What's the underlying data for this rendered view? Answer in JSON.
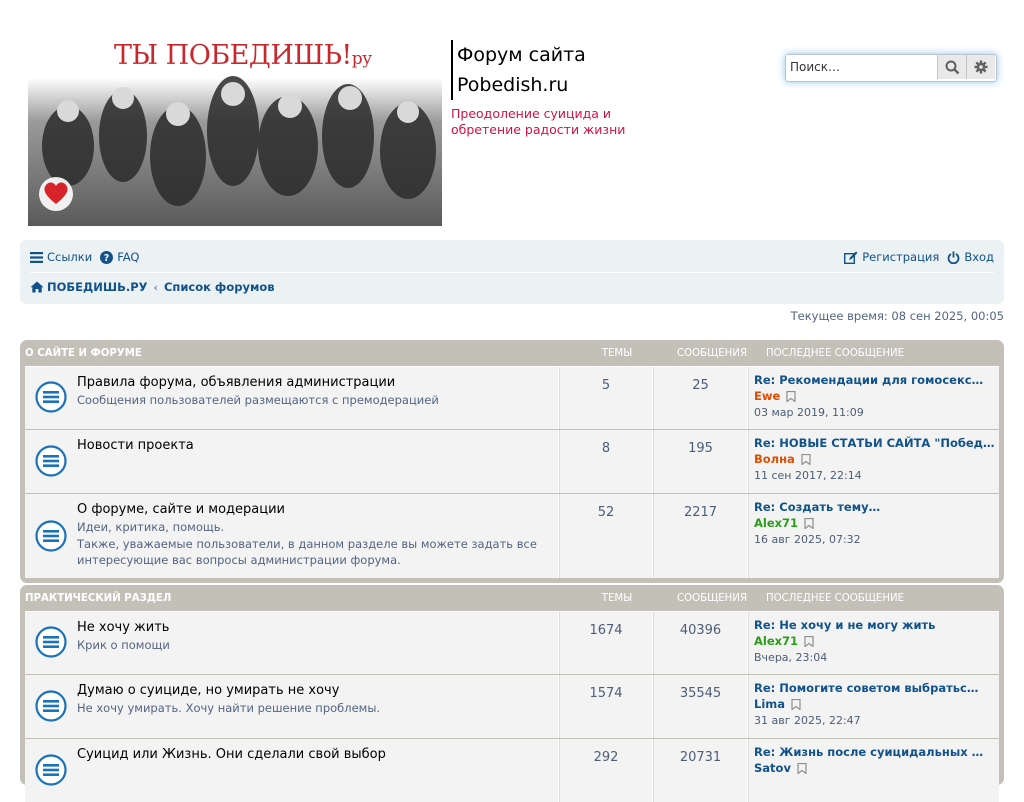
{
  "header": {
    "banner_title": "ТЫ ПОБЕДИШЬ!",
    "banner_suffix": "ру",
    "site_name_line1": "Форум сайта",
    "site_name_line2": "Pobedish.ru",
    "site_desc": "Преодоление суицида и обретение радости жизни",
    "search_placeholder": "Поиск…"
  },
  "nav": {
    "links": "Ссылки",
    "faq": "FAQ",
    "register": "Регистрация",
    "login": "Вход",
    "crumb_home": "ПОБЕДИШЬ.РУ",
    "crumb_sep": "‹",
    "crumb_forums": "Список форумов"
  },
  "current_time": "Текущее время: 08 сен 2025, 00:05",
  "blocks": [
    {
      "title": "О САЙТЕ И ФОРУМЕ",
      "col_topics": "ТЕМЫ",
      "col_posts": "СООБЩЕНИЯ",
      "col_last": "ПОСЛЕДНЕЕ СООБЩЕНИЕ",
      "forums": [
        {
          "title": "Правила форума, объявления администрации",
          "desc": "Сообщения пользователей размещаются с премодерацией",
          "desc2": "",
          "topics": "5",
          "posts": "25",
          "last_title": "Re: Рекомендации для гомосекс…",
          "last_author": "Ewe",
          "author_color": "#e14d00",
          "last_date": "03 мар 2019, 11:09"
        },
        {
          "title": "Новости проекта",
          "desc": "",
          "desc2": "",
          "topics": "8",
          "posts": "195",
          "last_title": "Re: НОВЫЕ СТАТЬИ САЙТА \"Побед…",
          "last_author": "Волна",
          "author_color": "#e14d00",
          "last_date": "11 сен 2017, 22:14"
        },
        {
          "title": "О форуме, сайте и модерации",
          "desc": "Идеи, критика, помощь.",
          "desc2": "Также, уважаемые пользователи, в данном разделе вы можете задать все интересующие вас вопросы администрации форума.",
          "topics": "52",
          "posts": "2217",
          "last_title": "Re: Создать тему…",
          "last_author": "Alex71",
          "author_color": "#2a9d18",
          "last_date": "16 авг 2025, 07:32"
        }
      ]
    },
    {
      "title": "ПРАКТИЧЕСКИЙ РАЗДЕЛ",
      "col_topics": "ТЕМЫ",
      "col_posts": "СООБЩЕНИЯ",
      "col_last": "ПОСЛЕДНЕЕ СООБЩЕНИЕ",
      "forums": [
        {
          "title": "Не хочу жить",
          "desc": "Крик о помощи",
          "desc2": "",
          "topics": "1674",
          "posts": "40396",
          "last_title": "Re: Не хочу и не могу жить",
          "last_author": "Alex71",
          "author_color": "#2a9d18",
          "last_date": "Вчера, 23:04"
        },
        {
          "title": "Думаю о суициде, но умирать не хочу",
          "desc": "Не хочу умирать. Хочу найти решение проблемы.",
          "desc2": "",
          "topics": "1574",
          "posts": "35545",
          "last_title": "Re: Помогите советом выбратьс…",
          "last_author": "Lima",
          "author_color": "#105289",
          "last_date": "31 авг 2025, 22:47"
        },
        {
          "title": "Суицид или Жизнь. Они сделали свой выбор",
          "desc": "",
          "desc2": "",
          "topics": "292",
          "posts": "20731",
          "last_title": "Re: Жизнь после суицидальных …",
          "last_author": "Satov",
          "author_color": "#105289",
          "last_date": ""
        }
      ]
    }
  ]
}
